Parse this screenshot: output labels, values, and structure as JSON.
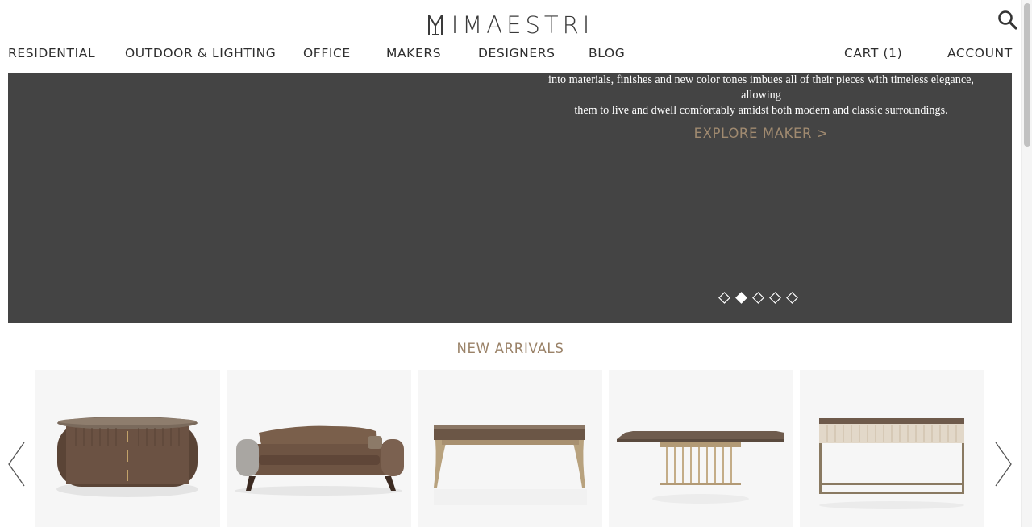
{
  "header": {
    "logo_text": "IMAESTRI",
    "logo_icon": "maestri-monogram",
    "search_icon": "search-icon"
  },
  "nav": {
    "left": [
      {
        "label": "RESIDENTIAL"
      },
      {
        "label": "OUTDOOR & LIGHTING"
      },
      {
        "label": "OFFICE"
      },
      {
        "label": "MAKERS"
      },
      {
        "label": "DESIGNERS"
      },
      {
        "label": "BLOG"
      }
    ],
    "cart_label": "CART (1)",
    "account_label": "ACCOUNT"
  },
  "hero": {
    "text_line1": "into materials, finishes and new color tones imbues all of their pieces with timeless elegance, allowing",
    "text_line2": "them to live and dwell comfortably amidst both modern and classic surroundings.",
    "cta_label": "EXPLORE MAKER >",
    "slide_count": 5,
    "active_slide": 2,
    "background_color": "#444444",
    "accent_color": "#a08a70"
  },
  "new_arrivals": {
    "title": "NEW ARRIVALS",
    "prev_icon": "chevron-left-icon",
    "next_icon": "chevron-right-icon",
    "products": [
      {
        "kind": "oval-cabinet"
      },
      {
        "kind": "leather-sofa"
      },
      {
        "kind": "marble-dining-table"
      },
      {
        "kind": "marble-table-brass-base"
      },
      {
        "kind": "console-table"
      }
    ]
  }
}
